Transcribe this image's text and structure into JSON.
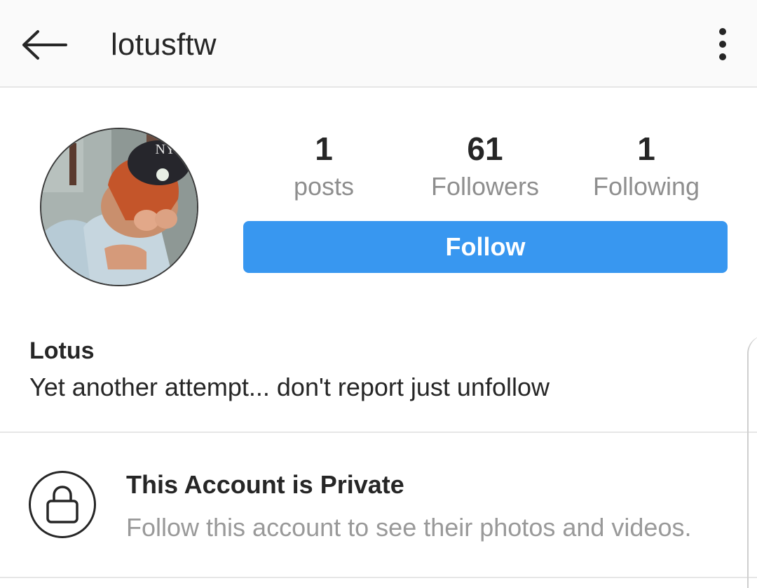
{
  "header": {
    "username": "lotusftw",
    "back_icon": "arrow-left-icon",
    "menu_icon": "more-vertical-icon"
  },
  "profile": {
    "avatar_icon": "profile-photo",
    "stats": [
      {
        "value": "1",
        "label": "posts"
      },
      {
        "value": "61",
        "label": "Followers"
      },
      {
        "value": "1",
        "label": "Following"
      }
    ],
    "follow_label": "Follow",
    "display_name": "Lotus",
    "bio": "Yet another attempt... don't report just unfollow"
  },
  "private_notice": {
    "icon": "lock-icon",
    "title": "This Account is Private",
    "subtitle": "Follow this account to see their photos and videos."
  },
  "colors": {
    "accent": "#3897f0",
    "text": "#262626",
    "muted": "#8e8e8e",
    "header_bg": "#fafafa",
    "divider": "#e6e6e6"
  }
}
